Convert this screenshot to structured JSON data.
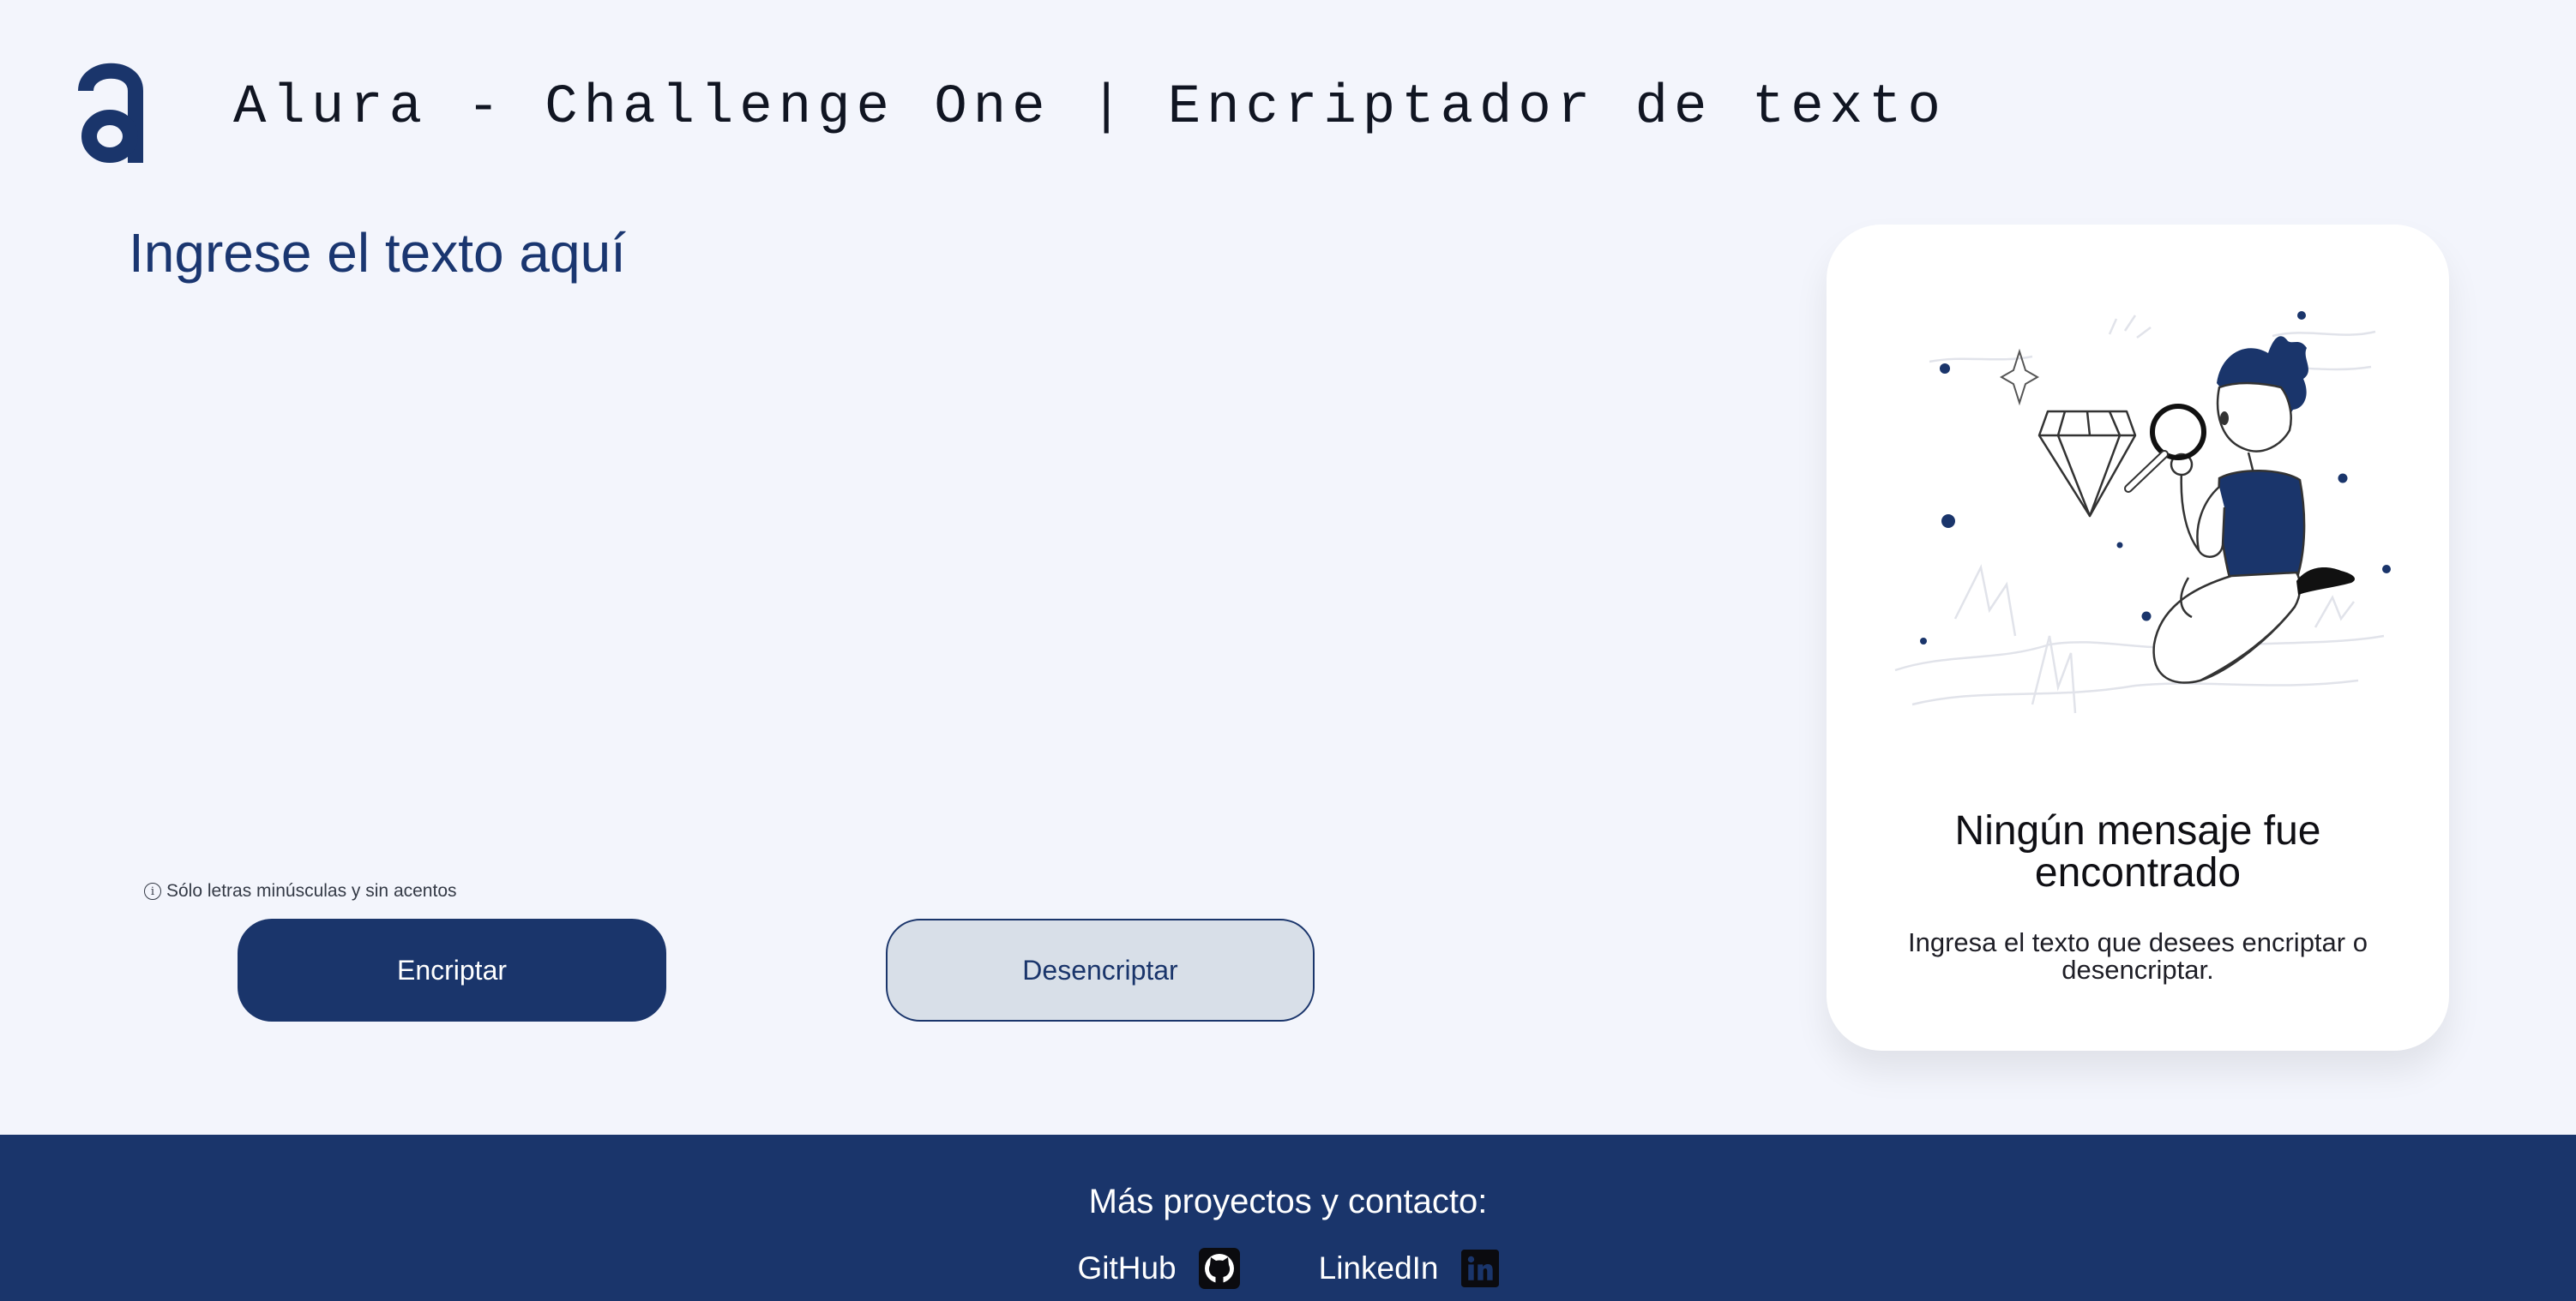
{
  "header": {
    "title": "Alura - Challenge One | Encriptador de texto",
    "logo_icon": "alura-logo-icon"
  },
  "input": {
    "placeholder": "Ingrese el texto aquí",
    "value": ""
  },
  "hint": {
    "icon": "ⓘ",
    "text": "Sólo letras minúsculas y sin acentos"
  },
  "buttons": {
    "encrypt_label": "Encriptar",
    "decrypt_label": "Desencriptar"
  },
  "result_card": {
    "illustration": "person-with-magnifying-glass-illustration",
    "title": "Ningún mensaje fue encontrado",
    "text": "Ingresa el texto que desees encriptar o desencriptar."
  },
  "footer": {
    "heading": "Más proyectos y contacto:",
    "links": [
      {
        "label": "GitHub",
        "icon": "github-icon"
      },
      {
        "label": "LinkedIn",
        "icon": "linkedin-icon"
      }
    ]
  },
  "colors": {
    "background": "#f3f5fc",
    "brand": "#1a356b",
    "secondary_button": "#d8dfe8",
    "card": "#ffffff"
  }
}
